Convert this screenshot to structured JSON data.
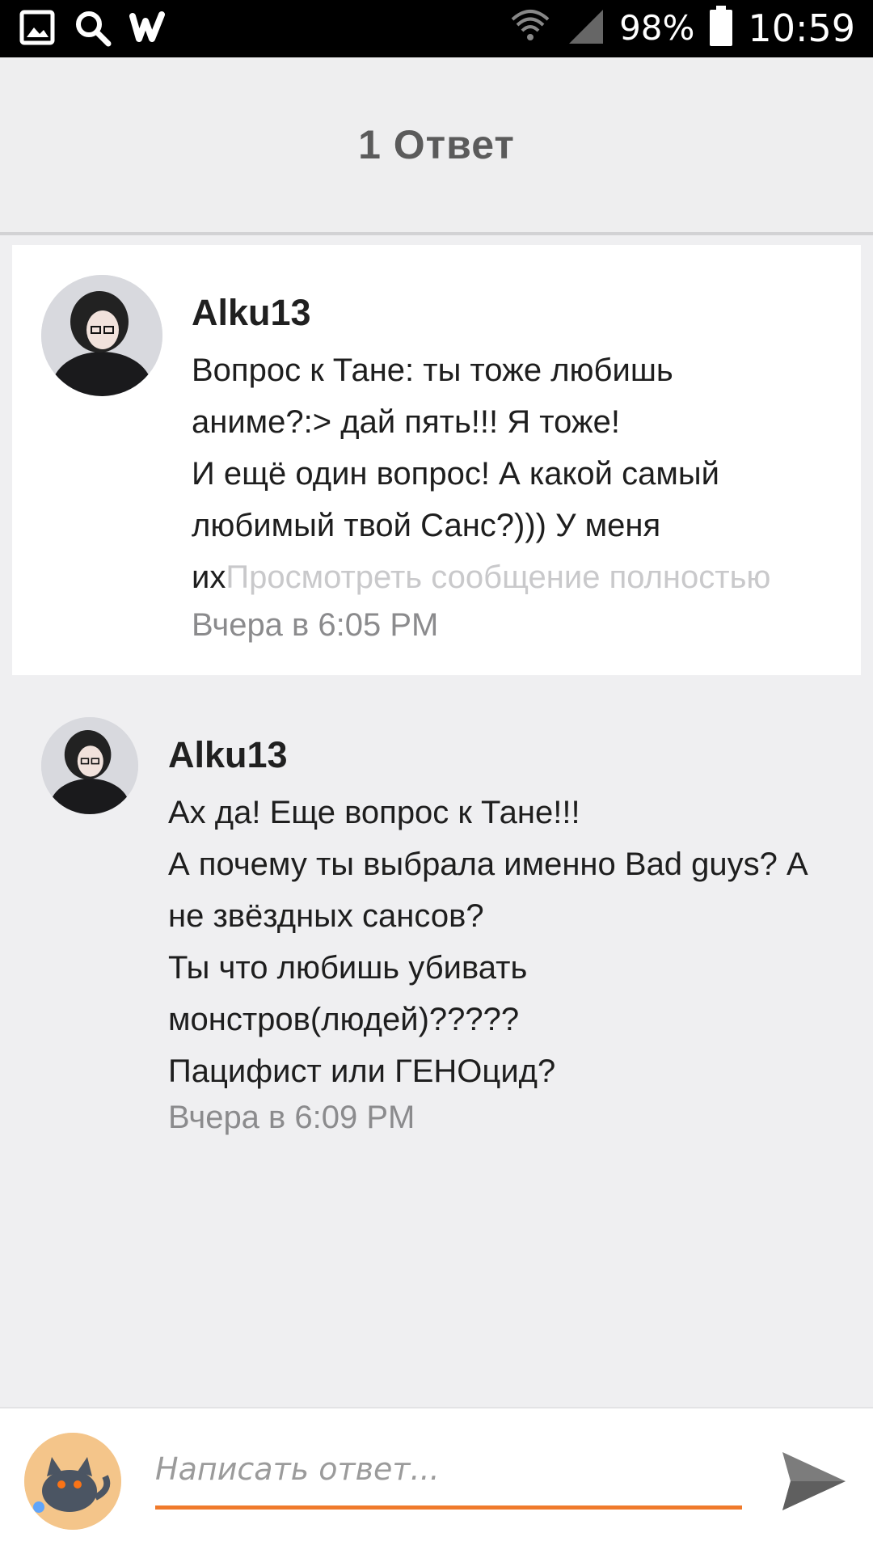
{
  "status_bar": {
    "battery": "98%",
    "time": "10:59",
    "icons": [
      "gallery-icon",
      "search-icon",
      "wattpad-icon",
      "wifi-icon",
      "signal-icon",
      "battery-icon"
    ]
  },
  "header": {
    "title": "1 Ответ"
  },
  "messages": [
    {
      "author": "Alku13",
      "text": "Вопрос к Тане: ты тоже любишь\nаниме?:> дай пять!!! Я тоже!\nИ ещё один вопрос! А какой самый\nлюбимый твой Санс?))) У меня\nих",
      "more_link": "Просмотреть сообщение полностью",
      "time": "Вчера в 6:05 PM"
    },
    {
      "author": "Alku13",
      "text": "Ах да! Еще вопрос к Тане!!!\nА почему ты выбрала именно Bad guys? А\nне звёздных сансов?\nТы что любишь убивать\nмонстров(людей)?????\nПацифист или ГЕНОцид?",
      "time": "Вчера в 6:09 PM"
    }
  ],
  "reply": {
    "placeholder": "Написать ответ...",
    "accent_color": "#f07a2b"
  }
}
